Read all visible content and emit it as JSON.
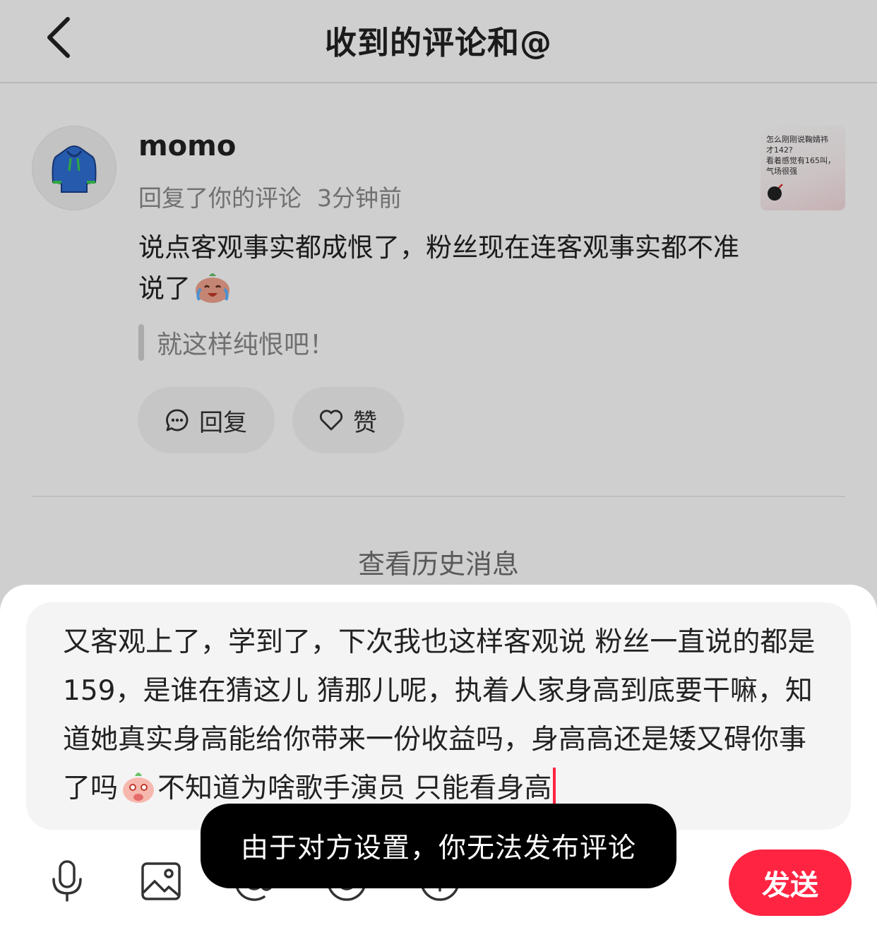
{
  "header": {
    "title": "收到的评论和@"
  },
  "notification": {
    "username": "momo",
    "action": "回复了你的评论",
    "time": "3分钟前",
    "comment": "说点客观事实都成恨了，粉丝现在连客观事实都不准说了",
    "comment_emoji": "laughing-crying-emoji",
    "quoted": "就这样纯恨吧！",
    "reply_label": "回复",
    "like_label": "赞",
    "thumbnail_text": [
      "怎么刚刚说鞠婧祎",
      "才142?",
      "看着感觉有165叫，",
      "气场很强"
    ]
  },
  "history_link": "查看历史消息",
  "composer": {
    "text_before_emoji": "又客观上了，学到了，下次我也这样客观说 粉丝一直说的都是159，是谁在猜这儿 猜那儿呢，执着人家身高到底要干嘛，知道她真实身高能给你带来一份收益吗，身高高还是矮又碍你事了吗",
    "emoji": "shy-peach-emoji",
    "text_after_emoji": "不知道为啥歌手演员 只能看身高",
    "send_label": "发送"
  },
  "toast": "由于对方设置，你无法发布评论",
  "colors": {
    "accent": "#ff2442",
    "toast_bg": "#000000",
    "input_bg": "#f4f4f5"
  }
}
